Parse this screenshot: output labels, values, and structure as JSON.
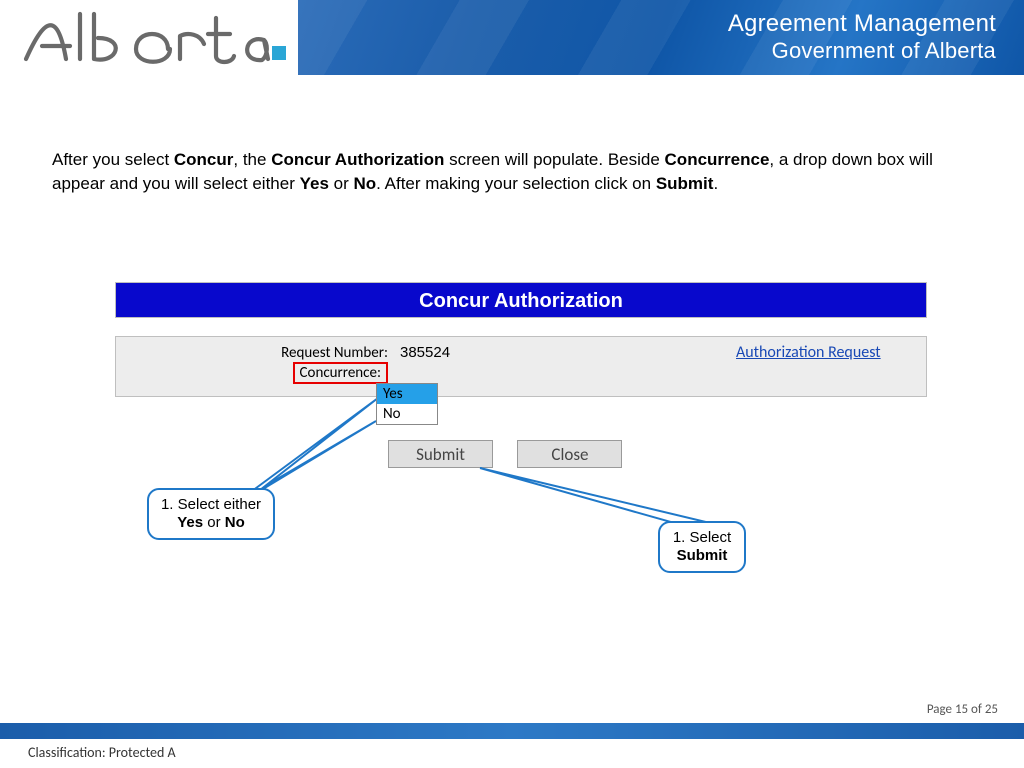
{
  "header": {
    "title1": "Agreement Management",
    "title2": "Government of Alberta"
  },
  "instruction": {
    "p1a": "After you select ",
    "b1": "Concur",
    "p1b": ", the ",
    "b2": "Concur Authorization",
    "p1c": " screen will populate.  Beside ",
    "b3": "Concurrence",
    "p1d": ", a drop down box will appear and you will select either ",
    "b4": "Yes",
    "p1e": " or ",
    "b5": "No",
    "p1f": ".  After making your selection click on ",
    "b6": "Submit",
    "p1g": "."
  },
  "panel": {
    "title": "Concur Authorization",
    "request_label": "Request Number:",
    "request_value": "385524",
    "concurrence_label": "Concurrence:",
    "auth_link": "Authorization Request",
    "options": {
      "opt1": "Yes",
      "opt2": "No"
    },
    "buttons": {
      "submit": "Submit",
      "close": "Close"
    }
  },
  "callouts": {
    "c1a": "1. Select either",
    "c1b_yes": "Yes",
    "c1b_or": " or ",
    "c1b_no": "No",
    "c2a": "1. Select",
    "c2b": "Submit"
  },
  "footer": {
    "classification": "Classification: Protected A",
    "pager": "Page 15 of 25"
  }
}
